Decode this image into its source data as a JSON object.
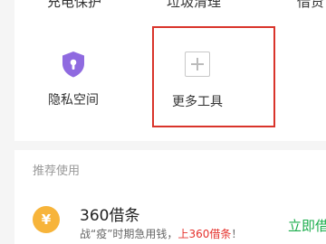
{
  "top_row": {
    "labels": [
      "充电保护",
      "垃圾清理",
      "借贷"
    ]
  },
  "tools": {
    "privacy": {
      "label": "隐私空间",
      "icon": "privacy-shield-icon",
      "icon_color": "#8f6ae0"
    },
    "more": {
      "label": "更多工具",
      "icon": "add-box-icon",
      "icon_color": "#bbbbbb"
    }
  },
  "highlight_color": "#d9342b",
  "recommend": {
    "section_title": "推荐使用",
    "loan": {
      "icon_symbol": "¥",
      "title": "360借条",
      "desc_prefix": "战“疫”时期急用钱，",
      "desc_highlight": "上360借条",
      "desc_suffix": "！",
      "action_label": "立即借"
    }
  }
}
